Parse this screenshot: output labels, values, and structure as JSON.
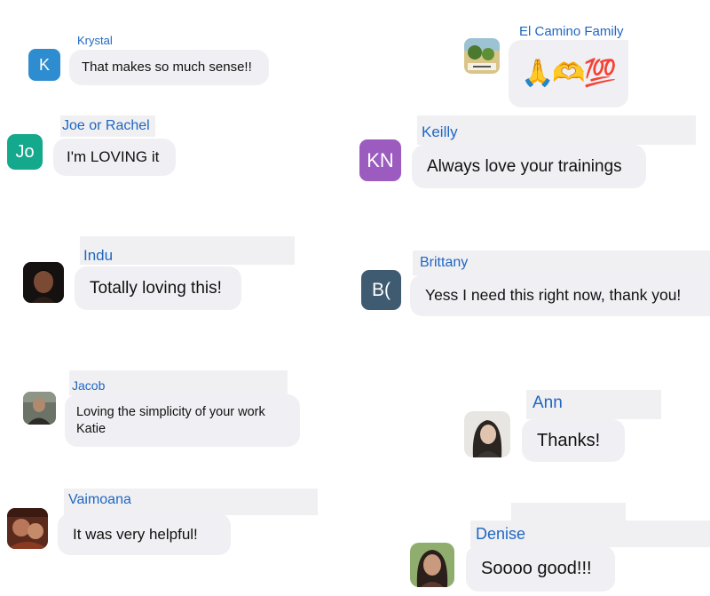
{
  "messages": [
    {
      "id": "krystal",
      "author": "Krystal",
      "initials": "K",
      "avatar_color": "#2e8dd0",
      "text": "That makes so much sense!!"
    },
    {
      "id": "joe-rachel",
      "author": "Joe or Rachel",
      "initials": "Jo",
      "avatar_color": "#14a88d",
      "text": "I'm LOVING it"
    },
    {
      "id": "indu",
      "author": "Indu",
      "avatar": "photo",
      "text": "Totally loving this!"
    },
    {
      "id": "jacob",
      "author": "Jacob",
      "avatar": "photo",
      "text": "Loving the simplicity of your work\nKatie"
    },
    {
      "id": "vaimoana",
      "author": "Vaimoana",
      "avatar": "photo",
      "text": "It was very helpful!"
    },
    {
      "id": "el-camino",
      "author": "El Camino Family",
      "avatar": "photo",
      "text": "🙏🫶💯"
    },
    {
      "id": "keilly",
      "author": "Keilly",
      "initials": "KN",
      "avatar_color": "#9b5bbf",
      "text": "Always love your trainings"
    },
    {
      "id": "brittany",
      "author": "Brittany",
      "initials": "B(",
      "avatar_color": "#3f5b72",
      "text": "Yess I need this right now, thank you!"
    },
    {
      "id": "ann",
      "author": "Ann",
      "avatar": "photo",
      "text": "Thanks!"
    },
    {
      "id": "denise",
      "author": "Denise",
      "avatar": "photo",
      "text": "Soooo good!!!"
    }
  ],
  "colors": {
    "name_text": "#1f66c1",
    "bubble_bg": "#f0f0f4",
    "message_text": "#111111"
  }
}
